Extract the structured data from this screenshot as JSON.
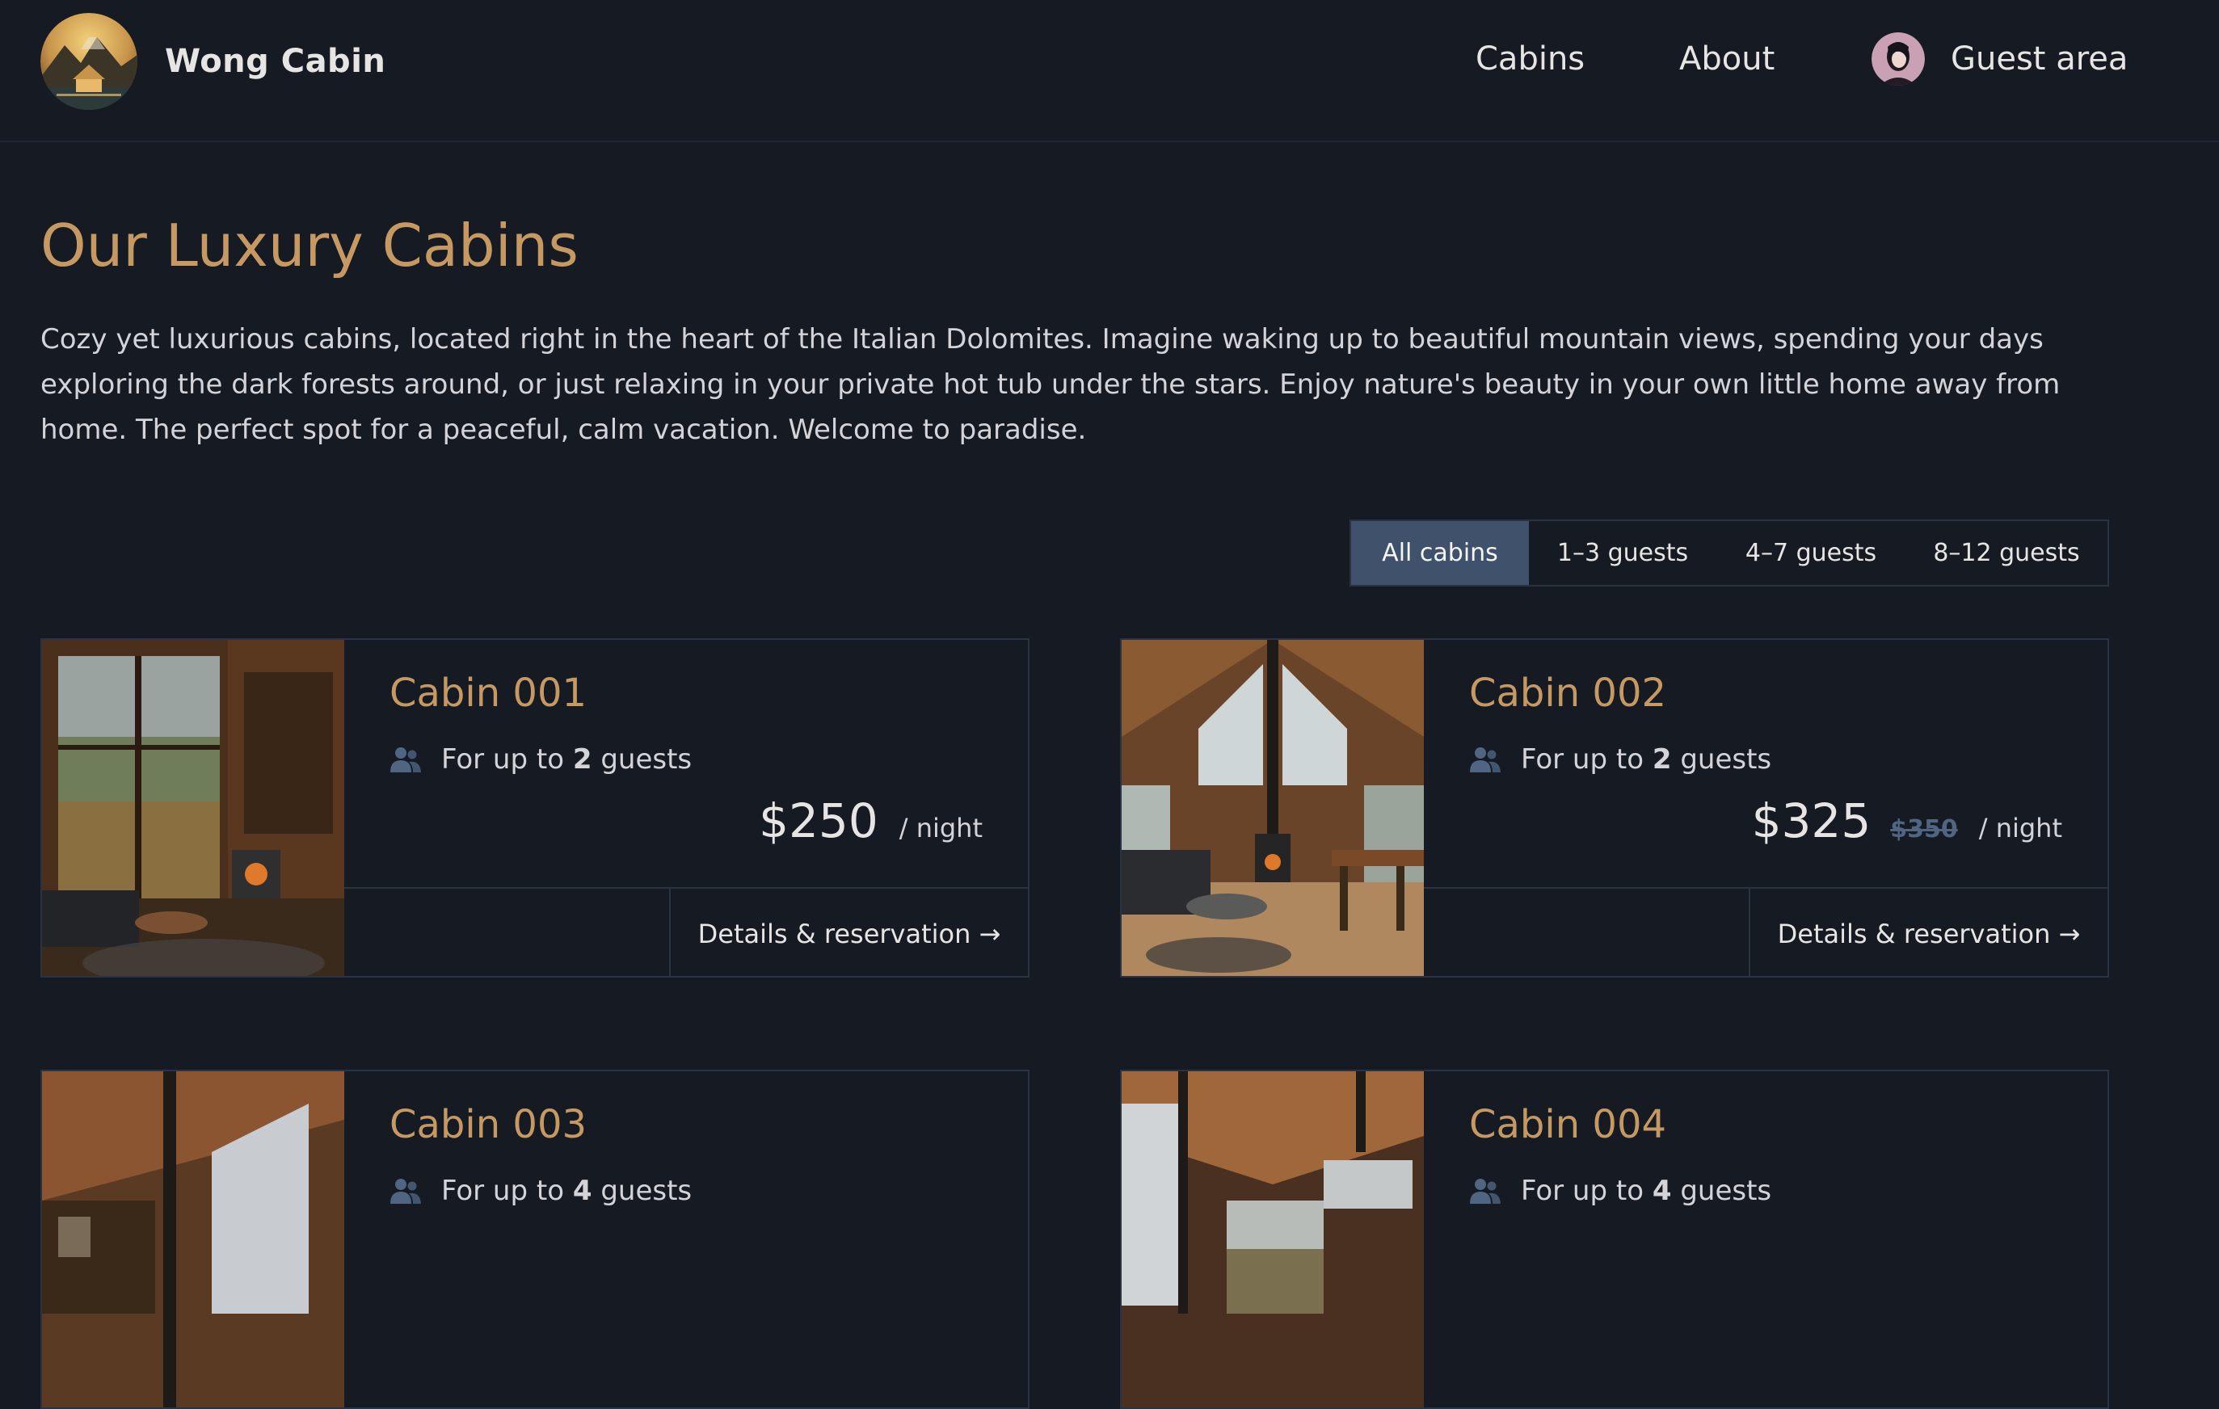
{
  "header": {
    "brand": "Wong Cabin",
    "nav": [
      {
        "label": "Cabins"
      },
      {
        "label": "About"
      },
      {
        "label": "Guest area"
      }
    ]
  },
  "main": {
    "title": "Our Luxury Cabins",
    "intro": "Cozy yet luxurious cabins, located right in the heart of the Italian Dolomites. Imagine waking up to beautiful mountain views, spending your days exploring the dark forests around, or just relaxing in your private hot tub under the stars. Enjoy nature's beauty in your own little home away from home. The perfect spot for a peaceful, calm vacation. Welcome to paradise.",
    "filters": [
      {
        "label": "All cabins",
        "active": true
      },
      {
        "label": "1–3 guests",
        "active": false
      },
      {
        "label": "4–7 guests",
        "active": false
      },
      {
        "label": "8–12 guests",
        "active": false
      }
    ],
    "guest_prefix": "For up to",
    "guest_suffix": "guests",
    "per_night": "/ night",
    "details_label": "Details & reservation →",
    "cabins": [
      {
        "name": "Cabin 001",
        "guests": "2",
        "price": "$250",
        "old_price": ""
      },
      {
        "name": "Cabin 002",
        "guests": "2",
        "price": "$325",
        "old_price": "$350"
      },
      {
        "name": "Cabin 003",
        "guests": "4",
        "price": "",
        "old_price": ""
      },
      {
        "name": "Cabin 004",
        "guests": "4",
        "price": "",
        "old_price": ""
      }
    ]
  },
  "colors": {
    "background": "#151a23",
    "accent": "#c69963",
    "active_filter": "#3f516b",
    "border": "#2a3342"
  }
}
